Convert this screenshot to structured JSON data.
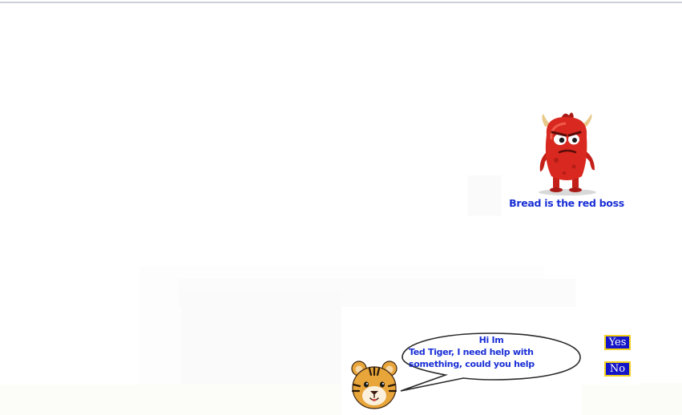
{
  "scene": {
    "boss": {
      "icon": "red-monster-boss-icon",
      "caption": "Bread is the red boss"
    },
    "dialog": {
      "speaker_icon": "tiger-face-icon",
      "title": "Hi Im",
      "lines": [
        "Ted Tiger, I need help with",
        "something, could you help"
      ]
    },
    "choices": {
      "yes_label": "Yes",
      "no_label": "No"
    }
  },
  "colors": {
    "text_blue": "#1a2fd6",
    "button_blue": "#1515c8",
    "button_border": "#f2d21a",
    "boss_red": "#d8281f",
    "tiger_orange": "#e8a53a"
  }
}
